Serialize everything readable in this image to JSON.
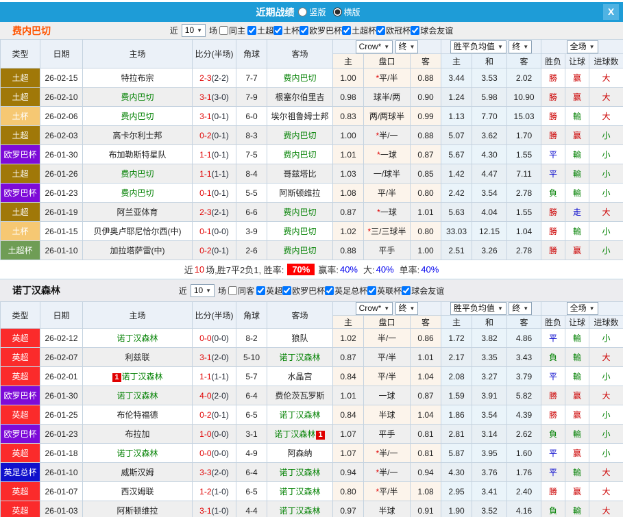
{
  "titlebar": {
    "title": "近期战绩",
    "radios": [
      {
        "label": "竖版",
        "selected": false
      },
      {
        "label": "横版",
        "selected": true
      }
    ],
    "close_label": "X"
  },
  "table_header": {
    "type": "类型",
    "date": "日期",
    "home": "主场",
    "score": "比分(半场)",
    "corner": "角球",
    "away": "客场",
    "crow_dropdown": "Crow*",
    "final_dropdown": "终",
    "avg_dropdown": "胜平负均值",
    "final2_dropdown": "终",
    "full_dropdown": "全场",
    "sub_home": "主",
    "sub_handicap": "盘口",
    "sub_away": "客",
    "sub_avg_home": "主",
    "sub_avg_draw": "和",
    "sub_avg_away": "客",
    "sub_wdl": "胜负",
    "sub_let": "让球",
    "sub_goals": "进球数"
  },
  "colors": {
    "titlebar_bg": "#1E9CD7",
    "accent_orange": "#FF5400",
    "self_team_green": "#008000",
    "score_red": "#E00000",
    "win_red": "#CC0000",
    "draw_blue": "#0000CC",
    "lose_green": "#008000",
    "rate_badge_bg": "#FF0000",
    "leagues": {
      "土超": "#A07808",
      "土杯": "#F6C873",
      "欧罗巴杯": "#7E0BD8",
      "土超杯": "#6F9D55",
      "英超": "#FB2B2B",
      "英足总杯": "#1111CC"
    }
  },
  "sections": [
    {
      "team": "费内巴切",
      "filter": {
        "near_label": "近",
        "games": "10",
        "games_label": "场",
        "same_label": "同主",
        "same_checked": false,
        "leagues": [
          {
            "label": "土超",
            "checked": true
          },
          {
            "label": "土杯",
            "checked": true
          },
          {
            "label": "欧罗巴杯",
            "checked": true
          },
          {
            "label": "土超杯",
            "checked": true
          },
          {
            "label": "欧冠杯",
            "checked": true
          },
          {
            "label": "球会友谊",
            "checked": true
          }
        ]
      },
      "rows": [
        {
          "league": "土超",
          "date": "26-02-15",
          "home": "特拉布宗",
          "home_self": false,
          "home_red": "",
          "score": "2-3",
          "half": "(2-2)",
          "corner": "7-7",
          "away": "费内巴切",
          "away_self": true,
          "away_red": "",
          "w1": "1.00",
          "pan": "*平/半",
          "w2": "0.88",
          "a1": "3.44",
          "a2": "3.53",
          "a3": "2.02",
          "r1": "勝",
          "r2": "赢",
          "r3": "大"
        },
        {
          "league": "土超",
          "date": "26-02-10",
          "home": "费内巴切",
          "home_self": true,
          "home_red": "",
          "score": "3-1",
          "half": "(3-0)",
          "corner": "7-9",
          "away": "根塞尔伯里吉",
          "away_self": false,
          "away_red": "",
          "w1": "0.98",
          "pan": "球半/两",
          "w2": "0.90",
          "a1": "1.24",
          "a2": "5.98",
          "a3": "10.90",
          "r1": "勝",
          "r2": "赢",
          "r3": "大"
        },
        {
          "league": "土杯",
          "date": "26-02-06",
          "home": "费内巴切",
          "home_self": true,
          "home_red": "",
          "score": "3-1",
          "half": "(0-1)",
          "corner": "6-0",
          "away": "埃尔祖鲁姆士邦",
          "away_self": false,
          "away_red": "",
          "w1": "0.83",
          "pan": "两/两球半",
          "w2": "0.99",
          "a1": "1.13",
          "a2": "7.70",
          "a3": "15.03",
          "r1": "勝",
          "r2": "輸",
          "r3": "大"
        },
        {
          "league": "土超",
          "date": "26-02-03",
          "home": "高卡尔利士邦",
          "home_self": false,
          "home_red": "",
          "score": "0-2",
          "half": "(0-1)",
          "corner": "8-3",
          "away": "费内巴切",
          "away_self": true,
          "away_red": "",
          "w1": "1.00",
          "pan": "*半/一",
          "w2": "0.88",
          "a1": "5.07",
          "a2": "3.62",
          "a3": "1.70",
          "r1": "勝",
          "r2": "赢",
          "r3": "小"
        },
        {
          "league": "欧罗巴杯",
          "date": "26-01-30",
          "home": "布加勒斯特星队",
          "home_self": false,
          "home_red": "",
          "score": "1-1",
          "half": "(0-1)",
          "corner": "7-5",
          "away": "费内巴切",
          "away_self": true,
          "away_red": "",
          "w1": "1.01",
          "pan": "*一球",
          "w2": "0.87",
          "a1": "5.67",
          "a2": "4.30",
          "a3": "1.55",
          "r1": "平",
          "r2": "輸",
          "r3": "小"
        },
        {
          "league": "土超",
          "date": "26-01-26",
          "home": "费内巴切",
          "home_self": true,
          "home_red": "",
          "score": "1-1",
          "half": "(1-1)",
          "corner": "8-4",
          "away": "哥兹塔比",
          "away_self": false,
          "away_red": "",
          "w1": "1.03",
          "pan": "一/球半",
          "w2": "0.85",
          "a1": "1.42",
          "a2": "4.47",
          "a3": "7.11",
          "r1": "平",
          "r2": "輸",
          "r3": "小"
        },
        {
          "league": "欧罗巴杯",
          "date": "26-01-23",
          "home": "费内巴切",
          "home_self": true,
          "home_red": "",
          "score": "0-1",
          "half": "(0-1)",
          "corner": "5-5",
          "away": "阿斯顿维拉",
          "away_self": false,
          "away_red": "",
          "w1": "1.08",
          "pan": "平/半",
          "w2": "0.80",
          "a1": "2.42",
          "a2": "3.54",
          "a3": "2.78",
          "r1": "負",
          "r2": "輸",
          "r3": "小"
        },
        {
          "league": "土超",
          "date": "26-01-19",
          "home": "阿兰亚体育",
          "home_self": false,
          "home_red": "",
          "score": "2-3",
          "half": "(2-1)",
          "corner": "6-6",
          "away": "费内巴切",
          "away_self": true,
          "away_red": "",
          "w1": "0.87",
          "pan": "*一球",
          "w2": "1.01",
          "a1": "5.63",
          "a2": "4.04",
          "a3": "1.55",
          "r1": "勝",
          "r2": "走",
          "r3": "大"
        },
        {
          "league": "土杯",
          "date": "26-01-15",
          "home": "贝伊奥卢耶尼恰尔西(中)",
          "home_self": false,
          "home_red": "",
          "score": "0-1",
          "half": "(0-0)",
          "corner": "3-9",
          "away": "费内巴切",
          "away_self": true,
          "away_red": "",
          "w1": "1.02",
          "pan": "*三/三球半",
          "w2": "0.80",
          "a1": "33.03",
          "a2": "12.15",
          "a3": "1.04",
          "r1": "勝",
          "r2": "輸",
          "r3": "小"
        },
        {
          "league": "土超杯",
          "date": "26-01-10",
          "home": "加拉塔萨雷(中)",
          "home_self": false,
          "home_red": "",
          "score": "0-2",
          "half": "(0-1)",
          "corner": "2-6",
          "away": "费内巴切",
          "away_self": true,
          "away_red": "",
          "w1": "0.88",
          "pan": "平手",
          "w2": "1.00",
          "a1": "2.51",
          "a2": "3.26",
          "a3": "2.78",
          "r1": "勝",
          "r2": "赢",
          "r3": "小"
        }
      ],
      "summary": {
        "near_label": "近",
        "games": "10",
        "text1": "场,胜7平2负1, 胜率:",
        "rate": "70%",
        "win_label": "赢率:",
        "win": "40%",
        "big_label": "大:",
        "big": "40%",
        "single_label": "单率:",
        "single": "40%"
      }
    },
    {
      "team": "诺丁汉森林",
      "filter": {
        "near_label": "近",
        "games": "10",
        "games_label": "场",
        "same_label": "同客",
        "same_checked": false,
        "leagues": [
          {
            "label": "英超",
            "checked": true
          },
          {
            "label": "欧罗巴杯",
            "checked": true
          },
          {
            "label": "英足总杯",
            "checked": true
          },
          {
            "label": "英联杯",
            "checked": true
          },
          {
            "label": "球会友谊",
            "checked": true
          }
        ]
      },
      "rows": [
        {
          "league": "英超",
          "date": "26-02-12",
          "home": "诺丁汉森林",
          "home_self": true,
          "home_red": "",
          "score": "0-0",
          "half": "(0-0)",
          "corner": "8-2",
          "away": "狼队",
          "away_self": false,
          "away_red": "",
          "w1": "1.02",
          "pan": "半/一",
          "w2": "0.86",
          "a1": "1.72",
          "a2": "3.82",
          "a3": "4.86",
          "r1": "平",
          "r2": "輸",
          "r3": "小"
        },
        {
          "league": "英超",
          "date": "26-02-07",
          "home": "利兹联",
          "home_self": false,
          "home_red": "",
          "score": "3-1",
          "half": "(2-0)",
          "corner": "5-10",
          "away": "诺丁汉森林",
          "away_self": true,
          "away_red": "",
          "w1": "0.87",
          "pan": "平/半",
          "w2": "1.01",
          "a1": "2.17",
          "a2": "3.35",
          "a3": "3.43",
          "r1": "負",
          "r2": "輸",
          "r3": "大"
        },
        {
          "league": "英超",
          "date": "26-02-01",
          "home": "诺丁汉森林",
          "home_self": true,
          "home_red": "1",
          "score": "1-1",
          "half": "(1-1)",
          "corner": "5-7",
          "away": "水晶宫",
          "away_self": false,
          "away_red": "",
          "w1": "0.84",
          "pan": "平/半",
          "w2": "1.04",
          "a1": "2.08",
          "a2": "3.27",
          "a3": "3.79",
          "r1": "平",
          "r2": "輸",
          "r3": "小"
        },
        {
          "league": "欧罗巴杯",
          "date": "26-01-30",
          "home": "诺丁汉森林",
          "home_self": true,
          "home_red": "",
          "score": "4-0",
          "half": "(2-0)",
          "corner": "6-4",
          "away": "费伦茨瓦罗斯",
          "away_self": false,
          "away_red": "",
          "w1": "1.01",
          "pan": "一球",
          "w2": "0.87",
          "a1": "1.59",
          "a2": "3.91",
          "a3": "5.82",
          "r1": "勝",
          "r2": "赢",
          "r3": "大"
        },
        {
          "league": "英超",
          "date": "26-01-25",
          "home": "布伦特福德",
          "home_self": false,
          "home_red": "",
          "score": "0-2",
          "half": "(0-1)",
          "corner": "6-5",
          "away": "诺丁汉森林",
          "away_self": true,
          "away_red": "",
          "w1": "0.84",
          "pan": "半球",
          "w2": "1.04",
          "a1": "1.86",
          "a2": "3.54",
          "a3": "4.39",
          "r1": "勝",
          "r2": "赢",
          "r3": "小"
        },
        {
          "league": "欧罗巴杯",
          "date": "26-01-23",
          "home": "布拉加",
          "home_self": false,
          "home_red": "",
          "score": "1-0",
          "half": "(0-0)",
          "corner": "3-1",
          "away": "诺丁汉森林",
          "away_self": true,
          "away_red": "1",
          "w1": "1.07",
          "pan": "平手",
          "w2": "0.81",
          "a1": "2.81",
          "a2": "3.14",
          "a3": "2.62",
          "r1": "負",
          "r2": "輸",
          "r3": "小"
        },
        {
          "league": "英超",
          "date": "26-01-18",
          "home": "诺丁汉森林",
          "home_self": true,
          "home_red": "",
          "score": "0-0",
          "half": "(0-0)",
          "corner": "4-9",
          "away": "阿森纳",
          "away_self": false,
          "away_red": "",
          "w1": "1.07",
          "pan": "*半/一",
          "w2": "0.81",
          "a1": "5.87",
          "a2": "3.95",
          "a3": "1.60",
          "r1": "平",
          "r2": "赢",
          "r3": "小"
        },
        {
          "league": "英足总杯",
          "date": "26-01-10",
          "home": "威斯汉姆",
          "home_self": false,
          "home_red": "",
          "score": "3-3",
          "half": "(2-0)",
          "corner": "6-4",
          "away": "诺丁汉森林",
          "away_self": true,
          "away_red": "",
          "w1": "0.94",
          "pan": "*半/一",
          "w2": "0.94",
          "a1": "4.30",
          "a2": "3.76",
          "a3": "1.76",
          "r1": "平",
          "r2": "輸",
          "r3": "大"
        },
        {
          "league": "英超",
          "date": "26-01-07",
          "home": "西汉姆联",
          "home_self": false,
          "home_red": "",
          "score": "1-2",
          "half": "(1-0)",
          "corner": "6-5",
          "away": "诺丁汉森林",
          "away_self": true,
          "away_red": "",
          "w1": "0.80",
          "pan": "*平/半",
          "w2": "1.08",
          "a1": "2.95",
          "a2": "3.41",
          "a3": "2.40",
          "r1": "勝",
          "r2": "赢",
          "r3": "大"
        },
        {
          "league": "英超",
          "date": "26-01-03",
          "home": "阿斯顿维拉",
          "home_self": false,
          "home_red": "",
          "score": "3-1",
          "half": "(1-0)",
          "corner": "4-4",
          "away": "诺丁汉森林",
          "away_self": true,
          "away_red": "",
          "w1": "0.97",
          "pan": "半球",
          "w2": "0.91",
          "a1": "1.90",
          "a2": "3.52",
          "a3": "4.16",
          "r1": "負",
          "r2": "輸",
          "r3": "大"
        }
      ]
    }
  ]
}
